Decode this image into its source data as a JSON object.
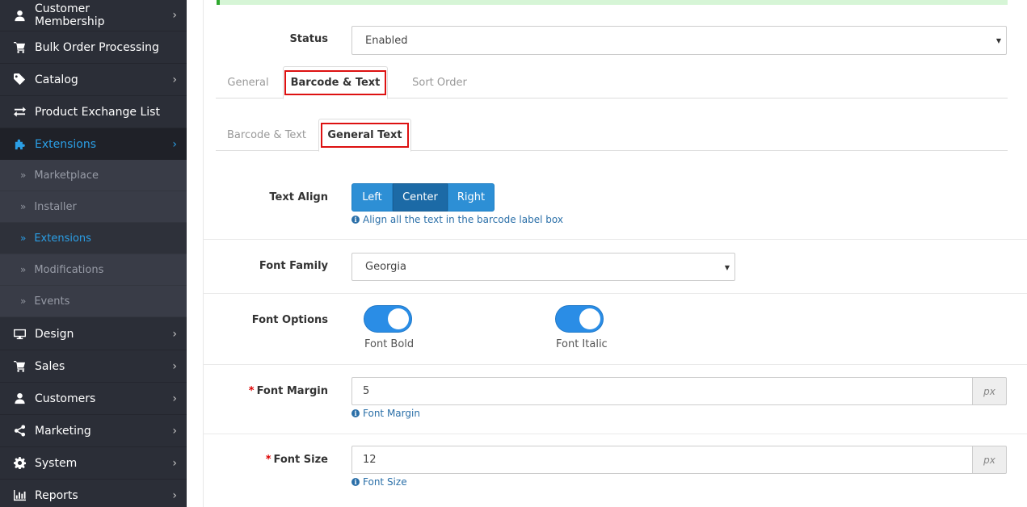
{
  "sidebar": {
    "items": [
      {
        "label": "Customer Membership",
        "icon": "user-icon",
        "chevron": true
      },
      {
        "label": "Bulk Order Processing",
        "icon": "cart-icon",
        "chevron": false
      },
      {
        "label": "Catalog",
        "icon": "tag-icon",
        "chevron": true
      },
      {
        "label": "Product Exchange List",
        "icon": "exchange-icon",
        "chevron": false
      },
      {
        "label": "Extensions",
        "icon": "puzzle-icon",
        "chevron": true,
        "active": true
      }
    ],
    "sub_items": [
      {
        "label": "Marketplace"
      },
      {
        "label": "Installer"
      },
      {
        "label": "Extensions",
        "active": true
      },
      {
        "label": "Modifications"
      },
      {
        "label": "Events"
      }
    ],
    "items_after": [
      {
        "label": "Design",
        "icon": "monitor-icon",
        "chevron": true
      },
      {
        "label": "Sales",
        "icon": "cart-icon",
        "chevron": true
      },
      {
        "label": "Customers",
        "icon": "user-icon",
        "chevron": true
      },
      {
        "label": "Marketing",
        "icon": "share-icon",
        "chevron": true
      },
      {
        "label": "System",
        "icon": "gear-icon",
        "chevron": true
      },
      {
        "label": "Reports",
        "icon": "bar-chart-icon",
        "chevron": true
      }
    ],
    "chevron_glyph": "›",
    "sub_glyph": "»"
  },
  "form": {
    "status": {
      "label": "Status",
      "value": "Enabled"
    },
    "tabs": [
      "General",
      "Barcode & Text",
      "Sort Order"
    ],
    "subtabs": [
      "Barcode & Text",
      "General Text"
    ],
    "text_align": {
      "label": "Text Align",
      "options": [
        "Left",
        "Center",
        "Right"
      ],
      "selected": "Center",
      "help": "Align all the text in the barcode label box"
    },
    "font_family": {
      "label": "Font Family",
      "value": "Georgia"
    },
    "font_options": {
      "label": "Font Options",
      "bold_label": "Font Bold",
      "italic_label": "Font Italic",
      "bold_on": true,
      "italic_on": true
    },
    "font_margin": {
      "label": "Font Margin",
      "value": "5",
      "unit": "px",
      "help": "Font Margin"
    },
    "font_size": {
      "label": "Font Size",
      "value": "12",
      "unit": "px",
      "help": "Font Size"
    }
  },
  "colors": {
    "accent": "#2d8fd5",
    "sidebar_bg": "#2b2e37",
    "highlight_border": "#dd1111"
  }
}
